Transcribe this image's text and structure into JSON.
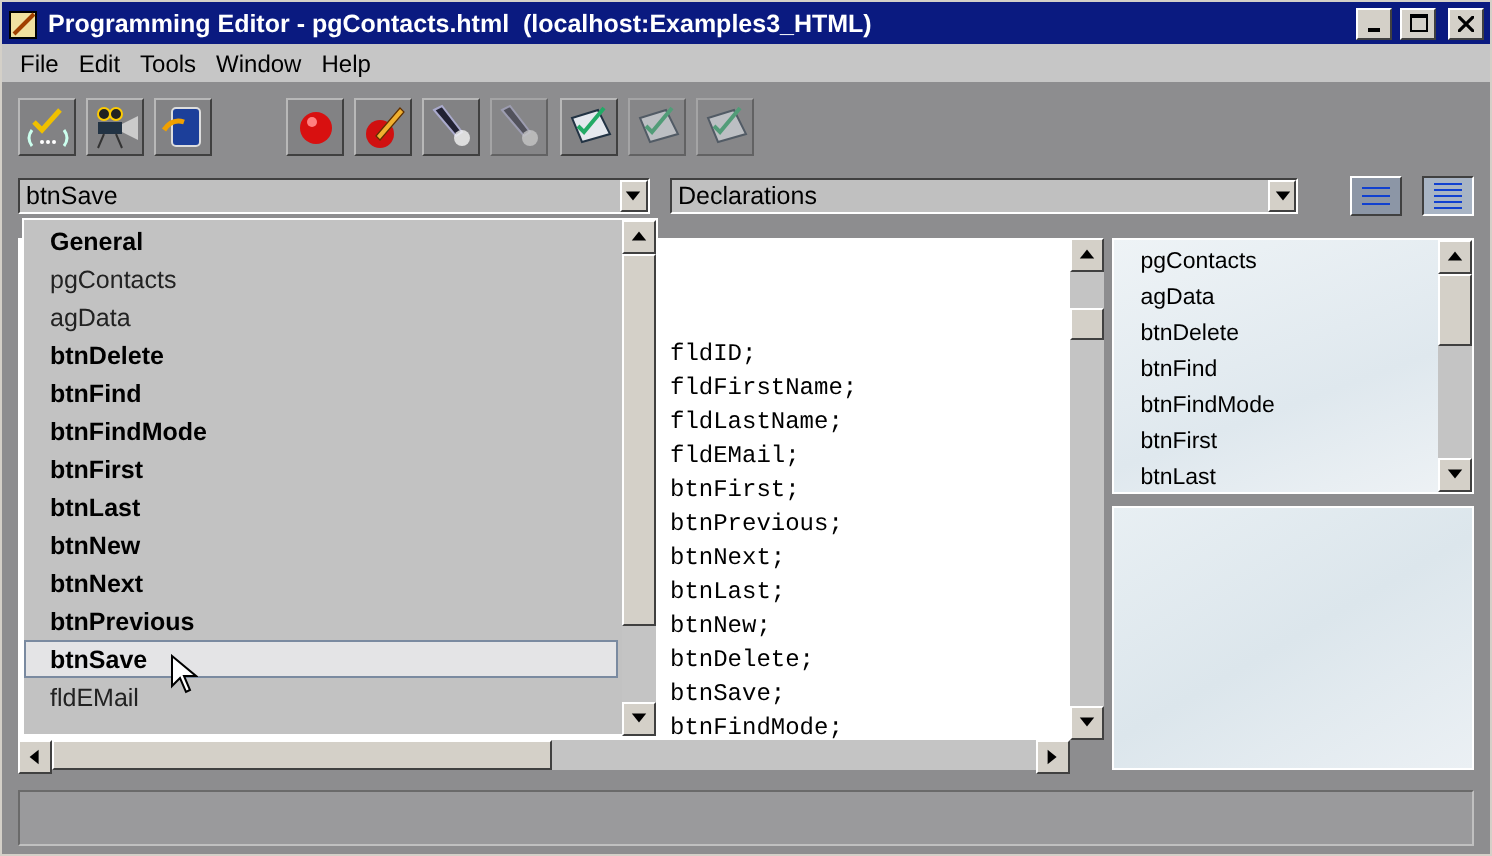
{
  "window": {
    "title": "Programming Editor - pgContacts.html  (localhost:Examples3_HTML)"
  },
  "menu": [
    "File",
    "Edit",
    "Tools",
    "Window",
    "Help"
  ],
  "toolbar_groups": [
    [
      {
        "kind": "check",
        "disabled": false
      },
      {
        "kind": "camera",
        "disabled": false
      },
      {
        "kind": "bucket",
        "disabled": false
      }
    ],
    [
      {
        "kind": "dot",
        "disabled": false
      },
      {
        "kind": "pencil",
        "disabled": false
      },
      {
        "kind": "flashlight",
        "disabled": false
      },
      {
        "kind": "flashlight",
        "disabled": true
      }
    ],
    [
      {
        "kind": "notepad",
        "disabled": false
      },
      {
        "kind": "notepad",
        "disabled": true
      },
      {
        "kind": "notepad",
        "disabled": true
      }
    ]
  ],
  "object_combo": {
    "value": "btnSave"
  },
  "procedure_combo": {
    "value": "Declarations"
  },
  "view_buttons": [
    {
      "kind": "procedure",
      "selected": false
    },
    {
      "kind": "full",
      "selected": true
    }
  ],
  "object_list": [
    {
      "label": "General",
      "bold": true,
      "selected": false
    },
    {
      "label": "pgContacts",
      "bold": false,
      "selected": false
    },
    {
      "label": "agData",
      "bold": false,
      "selected": false
    },
    {
      "label": "btnDelete",
      "bold": true,
      "selected": false
    },
    {
      "label": "btnFind",
      "bold": true,
      "selected": false
    },
    {
      "label": "btnFindMode",
      "bold": true,
      "selected": false
    },
    {
      "label": "btnFirst",
      "bold": true,
      "selected": false
    },
    {
      "label": "btnLast",
      "bold": true,
      "selected": false
    },
    {
      "label": "btnNew",
      "bold": true,
      "selected": false
    },
    {
      "label": "btnNext",
      "bold": true,
      "selected": false
    },
    {
      "label": "btnPrevious",
      "bold": true,
      "selected": false
    },
    {
      "label": "btnSave",
      "bold": true,
      "selected": true
    },
    {
      "label": "fldEMail",
      "bold": false,
      "selected": false
    }
  ],
  "code_lines": [
    "fldID;",
    "fldFirstName;",
    "fldLastName;",
    "fldEMail;",
    "btnFirst;",
    "btnPrevious;",
    "btnNext;",
    "btnLast;",
    "btnNew;",
    "btnDelete;",
    "btnSave;",
    "btnFindMode;"
  ],
  "side_list": [
    "pgContacts",
    "agData",
    "btnDelete",
    "btnFind",
    "btnFindMode",
    "btnFirst",
    "btnLast"
  ]
}
